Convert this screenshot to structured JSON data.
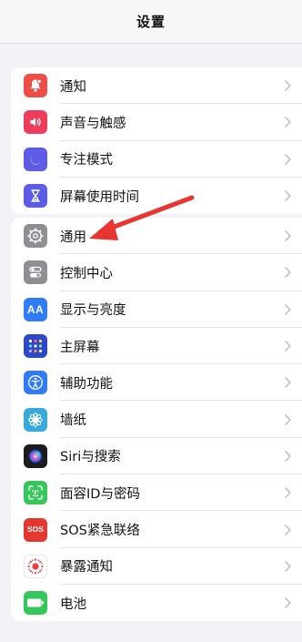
{
  "nav": {
    "title": "设置"
  },
  "group1": {
    "items": [
      {
        "label": "通知",
        "icon": "bell-icon",
        "color": "#ef4e47"
      },
      {
        "label": "声音与触感",
        "icon": "speaker-icon",
        "color": "#ee3d5c"
      },
      {
        "label": "专注模式",
        "icon": "moon-icon",
        "color": "#5e5ce6"
      },
      {
        "label": "屏幕使用时间",
        "icon": "hourglass-icon",
        "color": "#5e5ce6"
      }
    ]
  },
  "group2": {
    "items": [
      {
        "label": "通用",
        "icon": "gear-icon",
        "color": "#8e8e93"
      },
      {
        "label": "控制中心",
        "icon": "toggles-icon",
        "color": "#8e8e93"
      },
      {
        "label": "显示与亮度",
        "icon": "text-size-icon",
        "color": "#2f7cf6",
        "glyph": "AA"
      },
      {
        "label": "主屏幕",
        "icon": "home-grid-icon",
        "color": "#2b49c9"
      },
      {
        "label": "辅助功能",
        "icon": "accessibility-icon",
        "color": "#2f7cf6"
      },
      {
        "label": "墙纸",
        "icon": "flower-icon",
        "color": "#37aadc"
      },
      {
        "label": "Siri与搜索",
        "icon": "siri-icon",
        "color": "#1c1c1e"
      },
      {
        "label": "面容ID与密码",
        "icon": "face-id-icon",
        "color": "#35c75a"
      },
      {
        "label": "SOS紧急联络",
        "icon": "sos-icon",
        "color": "#e5372f",
        "glyph": "SOS"
      },
      {
        "label": "暴露通知",
        "icon": "exposure-icon",
        "color": "#ffffff"
      },
      {
        "label": "电池",
        "icon": "battery-icon",
        "color": "#35c75a"
      }
    ]
  },
  "annotation": {
    "arrow_color": "#e8352f"
  }
}
